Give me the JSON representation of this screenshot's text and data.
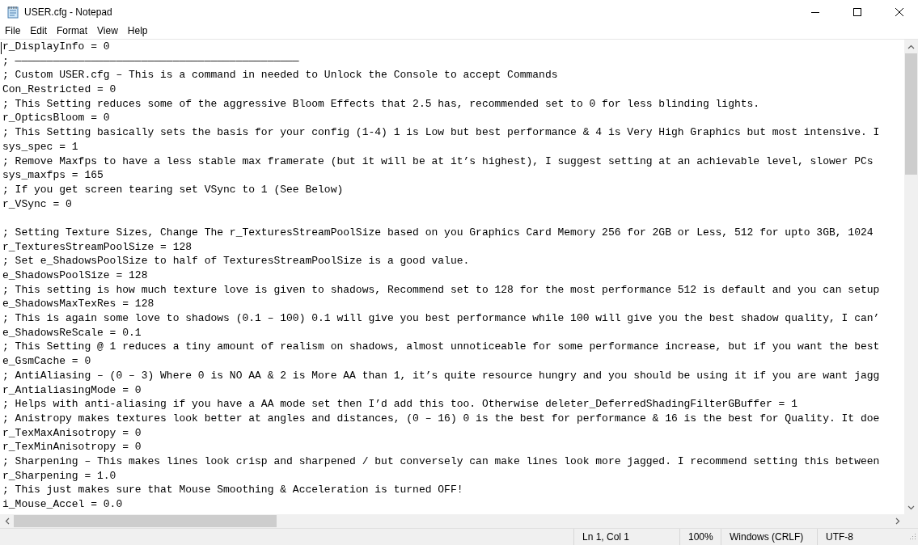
{
  "window": {
    "title": "USER.cfg - Notepad"
  },
  "menu": [
    "File",
    "Edit",
    "Format",
    "View",
    "Help"
  ],
  "editor": {
    "lines": [
      {
        "kind": "text",
        "text": "r_DisplayInfo = 0"
      },
      {
        "kind": "text",
        "text": "; —————————————————————————————————————————————"
      },
      {
        "kind": "text",
        "text": "; Custom USER.cfg – This is a command in needed to Unlock the Console to accept Commands"
      },
      {
        "kind": "text",
        "text": "Con_Restricted = 0"
      },
      {
        "kind": "text",
        "text": "; This Setting reduces some of the aggressive Bloom Effects that 2.5 has, recommended set to 0 for less blinding lights."
      },
      {
        "kind": "text",
        "text": "r_OpticsBloom = 0"
      },
      {
        "kind": "text",
        "text": "; This Setting basically sets the basis for your config (1-4) 1 is Low but best performance & 4 is Very High Graphics but most intensive. I"
      },
      {
        "kind": "text",
        "text": "sys_spec = 1"
      },
      {
        "kind": "text",
        "text": "; Remove Maxfps to have a less stable max framerate (but it will be at it’s highest), I suggest setting at an achievable level, slower PCs"
      },
      {
        "kind": "text",
        "text": "sys_maxfps = 165"
      },
      {
        "kind": "text",
        "text": "; If you get screen tearing set VSync to 1 (See Below)"
      },
      {
        "kind": "text",
        "text": "r_VSync = 0"
      },
      {
        "kind": "blank"
      },
      {
        "kind": "text",
        "text": "; Setting Texture Sizes, Change The r_TexturesStreamPoolSize based on you Graphics Card Memory 256 for 2GB or Less, 512 for upto 3GB, 1024"
      },
      {
        "kind": "text",
        "text": "r_TexturesStreamPoolSize = 128"
      },
      {
        "kind": "text",
        "text": "; Set e_ShadowsPoolSize to half of TexturesStreamPoolSize is a good value."
      },
      {
        "kind": "text",
        "text": "e_ShadowsPoolSize = 128"
      },
      {
        "kind": "text",
        "text": "; This setting is how much texture love is given to shadows, Recommend set to 128 for the most performance 512 is default and you can setup"
      },
      {
        "kind": "text",
        "text": "e_ShadowsMaxTexRes = 128"
      },
      {
        "kind": "text",
        "text": "; This is again some love to shadows (0.1 – 100) 0.1 will give you best performance while 100 will give you the best shadow quality, I can’"
      },
      {
        "kind": "text",
        "text": "e_ShadowsReScale = 0.1"
      },
      {
        "kind": "text",
        "text": "; This Setting @ 1 reduces a tiny amount of realism on shadows, almost unnoticeable for some performance increase, but if you want the best"
      },
      {
        "kind": "text",
        "text": "e_GsmCache = 0"
      },
      {
        "kind": "text",
        "text": "; AntiAliasing – (0 – 3) Where 0 is NO AA & 2 is More AA than 1, it’s quite resource hungry and you should be using it if you are want jagg"
      },
      {
        "kind": "text",
        "text": "r_AntialiasingMode = 0"
      },
      {
        "kind": "text",
        "text": "; Helps with anti-aliasing if you have a AA mode set then I’d add this too. Otherwise deleter_DeferredShadingFilterGBuffer = 1"
      },
      {
        "kind": "text",
        "text": "; Anistropy makes textures look better at angles and distances, (0 – 16) 0 is the best for performance & 16 is the best for Quality. It doe"
      },
      {
        "kind": "text",
        "text": "r_TexMaxAnisotropy = 0"
      },
      {
        "kind": "text",
        "text": "r_TexMinAnisotropy = 0"
      },
      {
        "kind": "text",
        "text": "; Sharpening – This makes lines look crisp and sharpened / but conversely can make lines look more jagged. I recommend setting this between"
      },
      {
        "kind": "text",
        "text": "r_Sharpening = 1.0"
      },
      {
        "kind": "text",
        "text": "; This just makes sure that Mouse Smoothing & Acceleration is turned OFF!"
      },
      {
        "kind": "text",
        "text": "i_Mouse_Accel = 0.0"
      }
    ]
  },
  "status_bar": {
    "position": "Ln 1, Col 1",
    "zoom": "100%",
    "line_ending": "Windows (CRLF)",
    "encoding": "UTF-8"
  }
}
